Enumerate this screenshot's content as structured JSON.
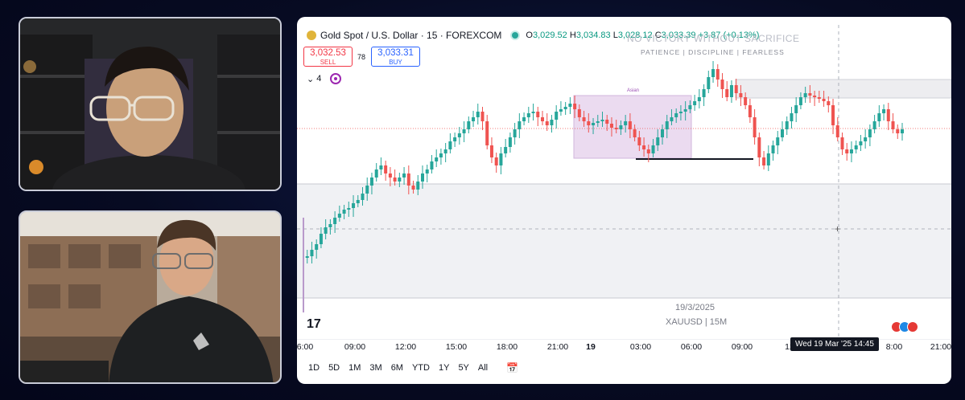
{
  "chart_header": {
    "title": "Gold Spot / U.S. Dollar · 15 · FOREXCOM",
    "open_label": "O",
    "open": "3,029.52",
    "high_label": "H",
    "high": "3,034.83",
    "low_label": "L",
    "low": "3,028.12",
    "close_label": "C",
    "close": "3,033.39",
    "change": "+3.87 (+0.13%)"
  },
  "watermark": {
    "line1": "NO VICTORY WITHOUT SACRIFICE",
    "line2": "PATIENCE | DISCIPLINE | FEARLESS"
  },
  "trade": {
    "sell_price": "3,032.53",
    "sell_label": "SELL",
    "spread": "78",
    "buy_price": "3,033.31",
    "buy_label": "BUY"
  },
  "indicators": {
    "count": "4"
  },
  "session_label": "Asian",
  "chart_footer": {
    "date": "19/3/2025",
    "symbol": "XAUUSD | 15M",
    "logo": "17"
  },
  "time_axis": [
    "6:00",
    "09:00",
    "12:00",
    "15:00",
    "18:00",
    "21:00",
    "19",
    "03:00",
    "06:00",
    "09:00",
    "12",
    "8:00",
    "21:00"
  ],
  "crosshair_time": "Wed 19 Mar '25   14:45",
  "ranges": [
    "1D",
    "5D",
    "1M",
    "3M",
    "6M",
    "YTD",
    "1Y",
    "5Y",
    "All"
  ],
  "colors": {
    "up": "#26a69a",
    "down": "#ef5350",
    "session_box": "#e1bee7",
    "background": "#070b22"
  },
  "icons": {
    "calendar": "calendar-icon",
    "tradingview": "tradingview-logo"
  }
}
